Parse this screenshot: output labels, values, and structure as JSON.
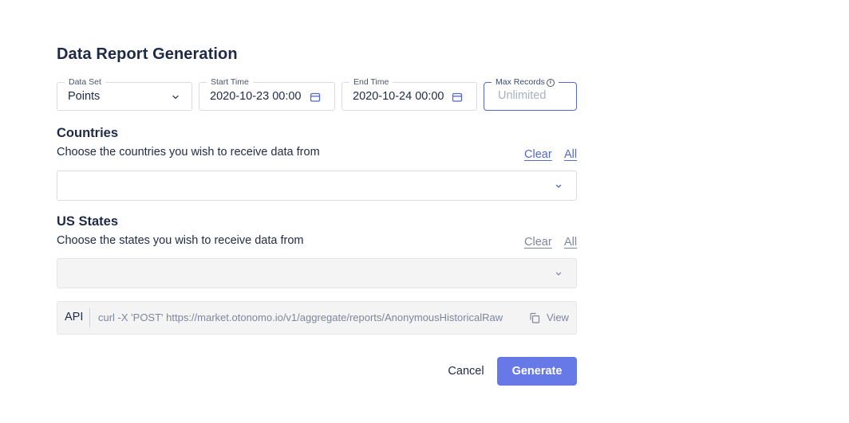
{
  "dialog": {
    "title": "Data Report Generation"
  },
  "filters": {
    "dataset": {
      "label": "Data Set",
      "value": "Points",
      "icon": "chevron-down-icon"
    },
    "start_time": {
      "label": "Start Time",
      "value": "2020-10-23 00:00",
      "icon": "calendar-icon"
    },
    "end_time": {
      "label": "End Time",
      "value": "2020-10-24 00:00",
      "icon": "calendar-icon"
    },
    "max_records": {
      "label": "Max Records",
      "placeholder": "Unlimited",
      "info_icon": "ⓘ"
    }
  },
  "countries": {
    "title": "Countries",
    "subtitle": "Choose the countries you wish to receive data from",
    "clear_label": "Clear",
    "all_label": "All"
  },
  "us_states": {
    "title": "US States",
    "subtitle": "Choose the states you wish to receive data from",
    "clear_label": "Clear",
    "all_label": "All",
    "disabled": true
  },
  "api": {
    "label": "API",
    "command": "curl -X 'POST' https://market.otonomo.io/v1/aggregate/reports/AnonymousHistoricalRaw",
    "view_label": "View",
    "copy_icon": "copy-icon"
  },
  "actions": {
    "cancel_label": "Cancel",
    "generate_label": "Generate"
  },
  "colors": {
    "accent": "#6779e6",
    "link": "#5468c7",
    "focus_border": "#5568c9",
    "muted_text": "#7e8699"
  }
}
